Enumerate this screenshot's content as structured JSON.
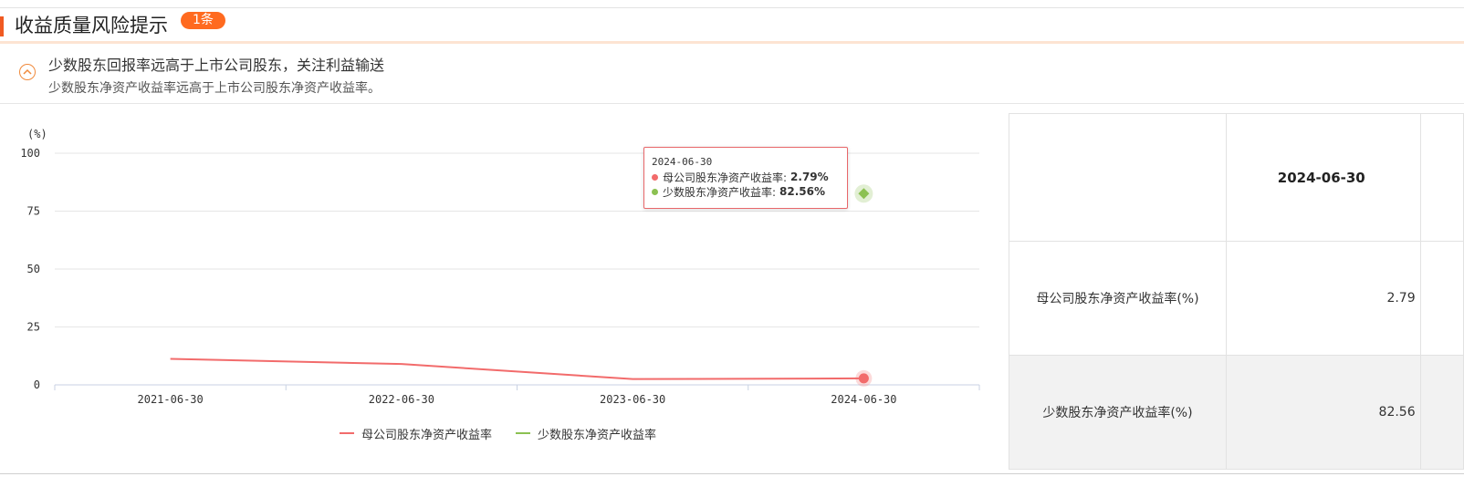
{
  "header": {
    "title": "收益质量风险提示",
    "badge": "1条"
  },
  "risk": {
    "title": "少数股东回报率远高于上市公司股东，关注利益输送",
    "description": "少数股东净资产收益率远高于上市公司股东净资产收益率。",
    "toggle_icon": "chevron-up-icon"
  },
  "chart_data": {
    "type": "line",
    "y_unit": "(%)",
    "ylim": [
      0,
      100
    ],
    "y_ticks": [
      0,
      25,
      50,
      75,
      100
    ],
    "x": [
      "2021-06-30",
      "2022-06-30",
      "2023-06-30",
      "2024-06-30"
    ],
    "grid": true,
    "legend_position": "bottom-center",
    "series": [
      {
        "name": "母公司股东净资产收益率",
        "color": "#f26b6b",
        "values": [
          11.2,
          9.0,
          2.5,
          2.79
        ]
      },
      {
        "name": "少数股东净资产收益率",
        "color": "#8cc152",
        "values": [
          null,
          null,
          null,
          82.56
        ]
      }
    ],
    "tooltip": {
      "date": "2024-06-30",
      "rows": [
        {
          "label": "母公司股东净资产收益率:",
          "value": "2.79%",
          "color": "#f26b6b"
        },
        {
          "label": "少数股东净资产收益率:",
          "value": "82.56%",
          "color": "#8cc152"
        }
      ]
    }
  },
  "table": {
    "date_header": "2024-06-30",
    "rows": [
      {
        "label": "母公司股东净资产收益率(%)",
        "value": "2.79"
      },
      {
        "label": "少数股东净资产收益率(%)",
        "value": "82.56"
      }
    ]
  }
}
